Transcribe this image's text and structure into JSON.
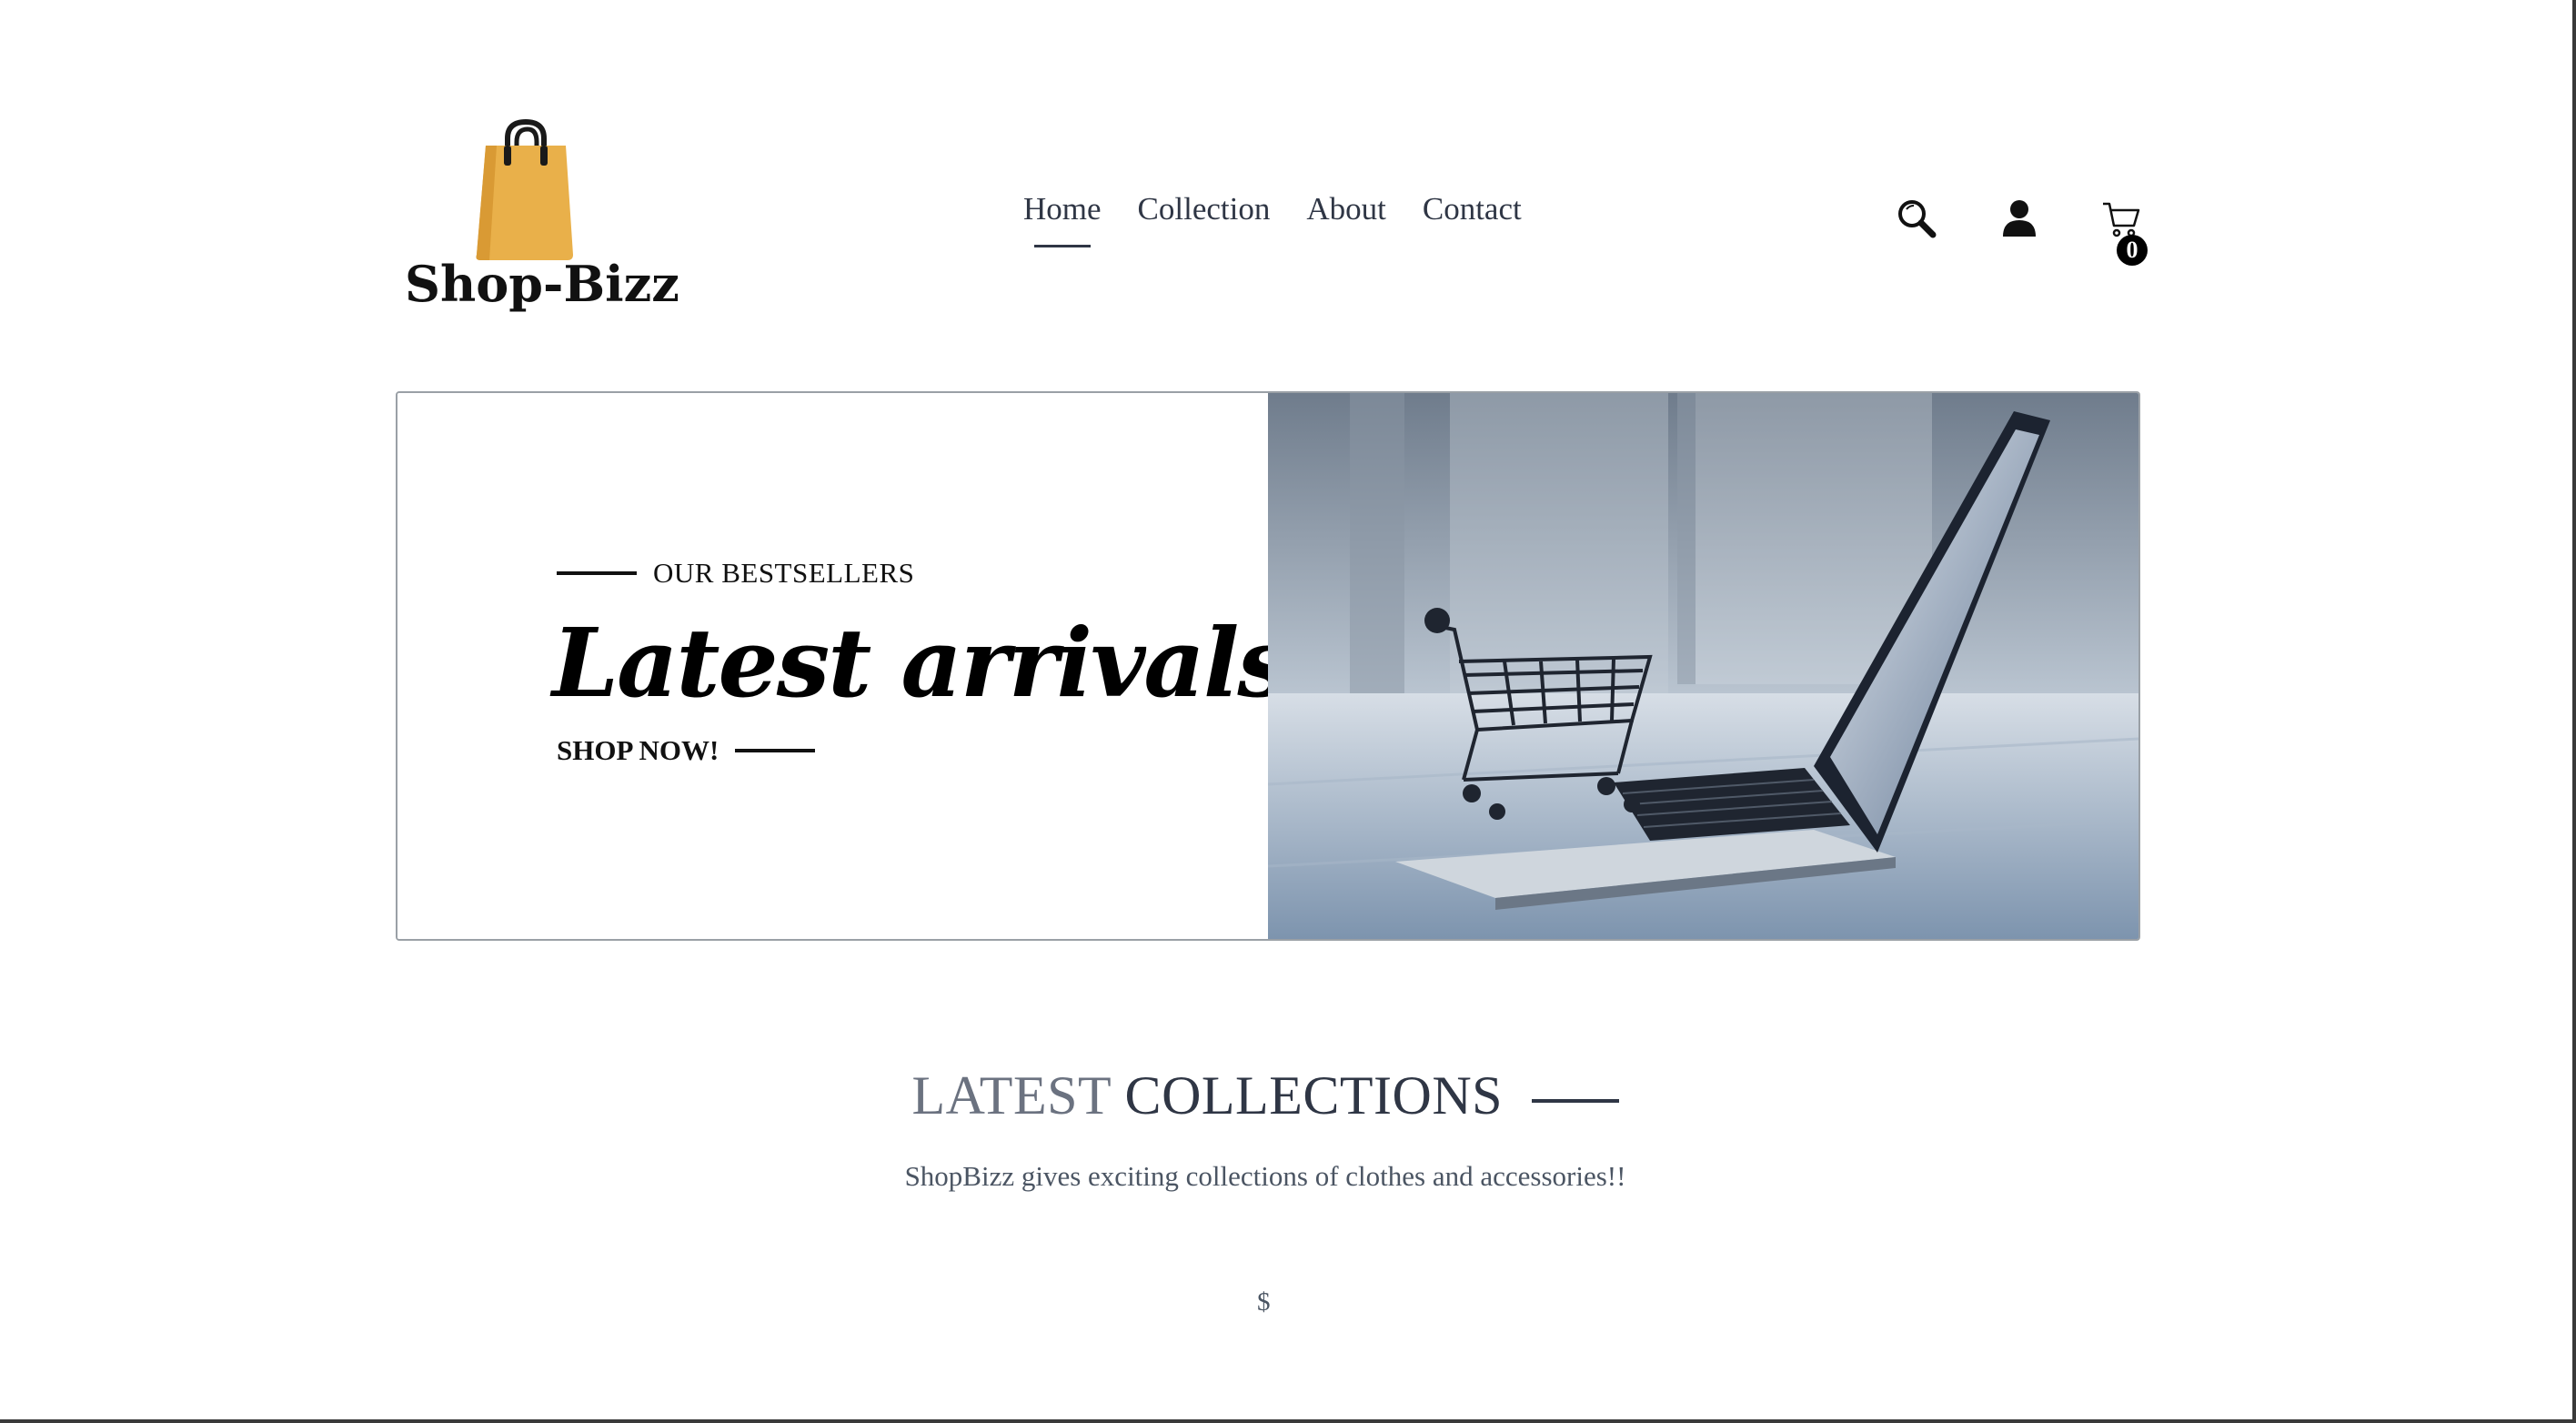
{
  "brand": {
    "name": "Shop-Bizz",
    "accent_color": "#E9B04A",
    "logo_icon": "shopping-bag-icon"
  },
  "nav": {
    "items": [
      {
        "label": "Home",
        "active": true
      },
      {
        "label": "Collection",
        "active": false
      },
      {
        "label": "About",
        "active": false
      },
      {
        "label": "Contact",
        "active": false
      }
    ]
  },
  "header_icons": {
    "search": "search-icon",
    "account": "user-icon",
    "cart": "cart-icon",
    "cart_count": "0"
  },
  "hero": {
    "subtitle": "OUR BESTSELLERS",
    "title": "Latest arrivals",
    "cta": "SHOP NOW!",
    "image": "laptop-with-shopping-cart-photo"
  },
  "collections": {
    "title_light": "LATEST",
    "title_dark": "COLLECTIONS",
    "description": "ShopBizz gives exciting collections of clothes and accessories!!",
    "price_symbol": "$"
  }
}
